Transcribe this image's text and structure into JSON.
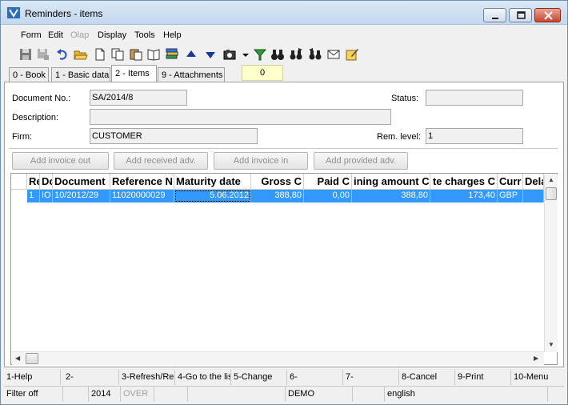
{
  "window": {
    "title": "Reminders - items"
  },
  "menu": [
    "Form",
    "Edit",
    "Olap",
    "Display",
    "Tools",
    "Help"
  ],
  "menu_disabled": [
    "Olap"
  ],
  "toolbar": [
    "save-icon",
    "save-disabled-icon",
    "undo-icon",
    "open-folder-icon",
    "new-document-icon",
    "copy-icon",
    "paste-icon",
    "book-icon",
    "stack-icon",
    "arrow-up-icon",
    "arrow-down-icon",
    "camera-icon",
    "dropdown-arrow-icon",
    "filter-icon",
    "binoculars-icon",
    "binoculars-next-icon",
    "binoculars-prev-icon",
    "mail-icon",
    "edit-note-icon"
  ],
  "tabs": [
    "0 - Book",
    "1 - Basic data",
    "2 - Items",
    "9 - Attachments"
  ],
  "active_tab": "2 - Items",
  "tab_counter": "0",
  "form": {
    "document_no_label": "Document No.:",
    "document_no": "SA/2014/8",
    "description_label": "Description:",
    "description": "",
    "firm_label": "Firm:",
    "firm": "CUSTOMER",
    "status_label": "Status:",
    "status": "",
    "rem_level_label": "Rem. level:",
    "rem_level": "1"
  },
  "actions": [
    "Add invoice out",
    "Add received adv.",
    "Add invoice in",
    "Add provided adv."
  ],
  "grid": {
    "columns": [
      "Re",
      "Dc",
      "Document",
      "Reference N",
      "Maturity date",
      "Gross C",
      "Paid C",
      "ining amount C",
      "te charges C",
      "Curr",
      "Dela"
    ],
    "rows": [
      [
        "1",
        "IO",
        "10/2012/29",
        "11020000029",
        "5.06.2012",
        "388,80",
        "0,00",
        "388,80",
        "173,40",
        "GBP",
        ""
      ]
    ]
  },
  "function_keys": [
    "1-Help",
    "2-",
    "3-Refresh/Re",
    "4-Go to the lis",
    "5-Change",
    "6-",
    "7-",
    "8-Cancel",
    "9-Print",
    "10-Menu"
  ],
  "status_bar": [
    "Filter off",
    "",
    "2014",
    "OVER",
    "",
    "",
    "DEMO",
    "",
    "english",
    ""
  ],
  "colors": {
    "selection": "#3399ff",
    "counter_bg": "#ffffcc",
    "titlebar": "#c3d7ee"
  }
}
